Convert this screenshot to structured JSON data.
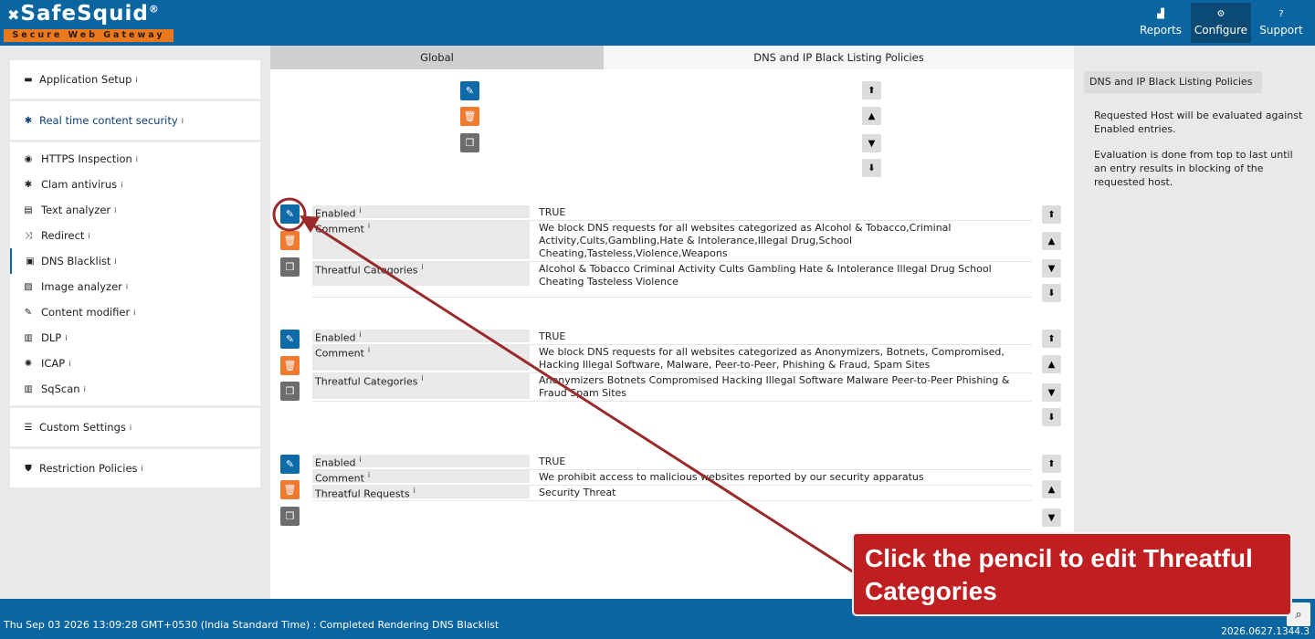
{
  "app": {
    "logo_name": "SafeSquid",
    "logo_reg": "®",
    "logo_tagline": "Secure Web Gateway"
  },
  "topnav": {
    "reports": "Reports",
    "configure": "Configure",
    "support": "Support"
  },
  "sidebar": {
    "application_setup": "Application Setup",
    "realtime_security": "Real time content security",
    "items": [
      {
        "label": "HTTPS Inspection",
        "icon": "eye-icon"
      },
      {
        "label": "Clam antivirus",
        "icon": "bug-icon"
      },
      {
        "label": "Text analyzer",
        "icon": "document-icon"
      },
      {
        "label": "Redirect",
        "icon": "shuffle-icon"
      },
      {
        "label": "DNS Blacklist",
        "icon": "dns-icon"
      },
      {
        "label": "Image analyzer",
        "icon": "image-icon"
      },
      {
        "label": "Content modifier",
        "icon": "edit-icon"
      },
      {
        "label": "DLP",
        "icon": "barcode-icon"
      },
      {
        "label": "ICAP",
        "icon": "cog-icon"
      },
      {
        "label": "SqScan",
        "icon": "barcode-icon"
      }
    ],
    "custom_settings": "Custom Settings",
    "restriction_policies": "Restriction Policies",
    "info_mark": "i"
  },
  "tabs": {
    "global": "Global",
    "dns": "DNS and IP Black Listing Policies"
  },
  "entries": [
    {
      "fields": [
        {
          "name": "Enabled",
          "value": "TRUE"
        },
        {
          "name": "Comment",
          "value": "We block DNS requests for all websites categorized as Alcohol & Tobacco,Criminal Activity,Cults,Gambling,Hate & Intolerance,Illegal Drug,School Cheating,Tasteless,Violence,Weapons"
        },
        {
          "name": "Threatful Categories",
          "value": "Alcohol & Tobacco  Criminal Activity  Cults  Gambling  Hate & Intolerance  Illegal Drug  School Cheating  Tasteless  Violence"
        }
      ]
    },
    {
      "fields": [
        {
          "name": "Enabled",
          "value": "TRUE"
        },
        {
          "name": "Comment",
          "value": "We block DNS requests for all websites categorized as Anonymizers, Botnets, Compromised, Hacking Illegal Software, Malware, Peer-to-Peer, Phishing & Fraud, Spam Sites"
        },
        {
          "name": "Threatful Categories",
          "value": "Anonymizers  Botnets  Compromised  Hacking  Illegal Software  Malware  Peer-to-Peer  Phishing & Fraud  Spam Sites"
        }
      ]
    },
    {
      "fields": [
        {
          "name": "Enabled",
          "value": "TRUE"
        },
        {
          "name": "Comment",
          "value": "We prohibit access to malicious websites reported by our security apparatus"
        },
        {
          "name": "Threatful Requests",
          "value": "Security Threat"
        }
      ]
    }
  ],
  "help": {
    "title": "DNS and IP Black Listing Policies",
    "para1": "Requested Host will be evaluated against Enabled entries.",
    "para2": "Evaluation is done from top to last until an entry results in blocking of the requested host."
  },
  "status": {
    "text": "Thu Sep 03 2026 13:09:28 GMT+0530 (India Standard Time) : Completed Rendering DNS Blacklist",
    "version": "2026.0627.1344.3"
  },
  "annotation": {
    "text": "Click the pencil to edit Threatful Categories",
    "color": "#c01f22"
  },
  "colors": {
    "header": "#0a65a0",
    "edit": "#0e6ba8",
    "delete": "#f07a2f",
    "copy": "#6d6d6d"
  }
}
